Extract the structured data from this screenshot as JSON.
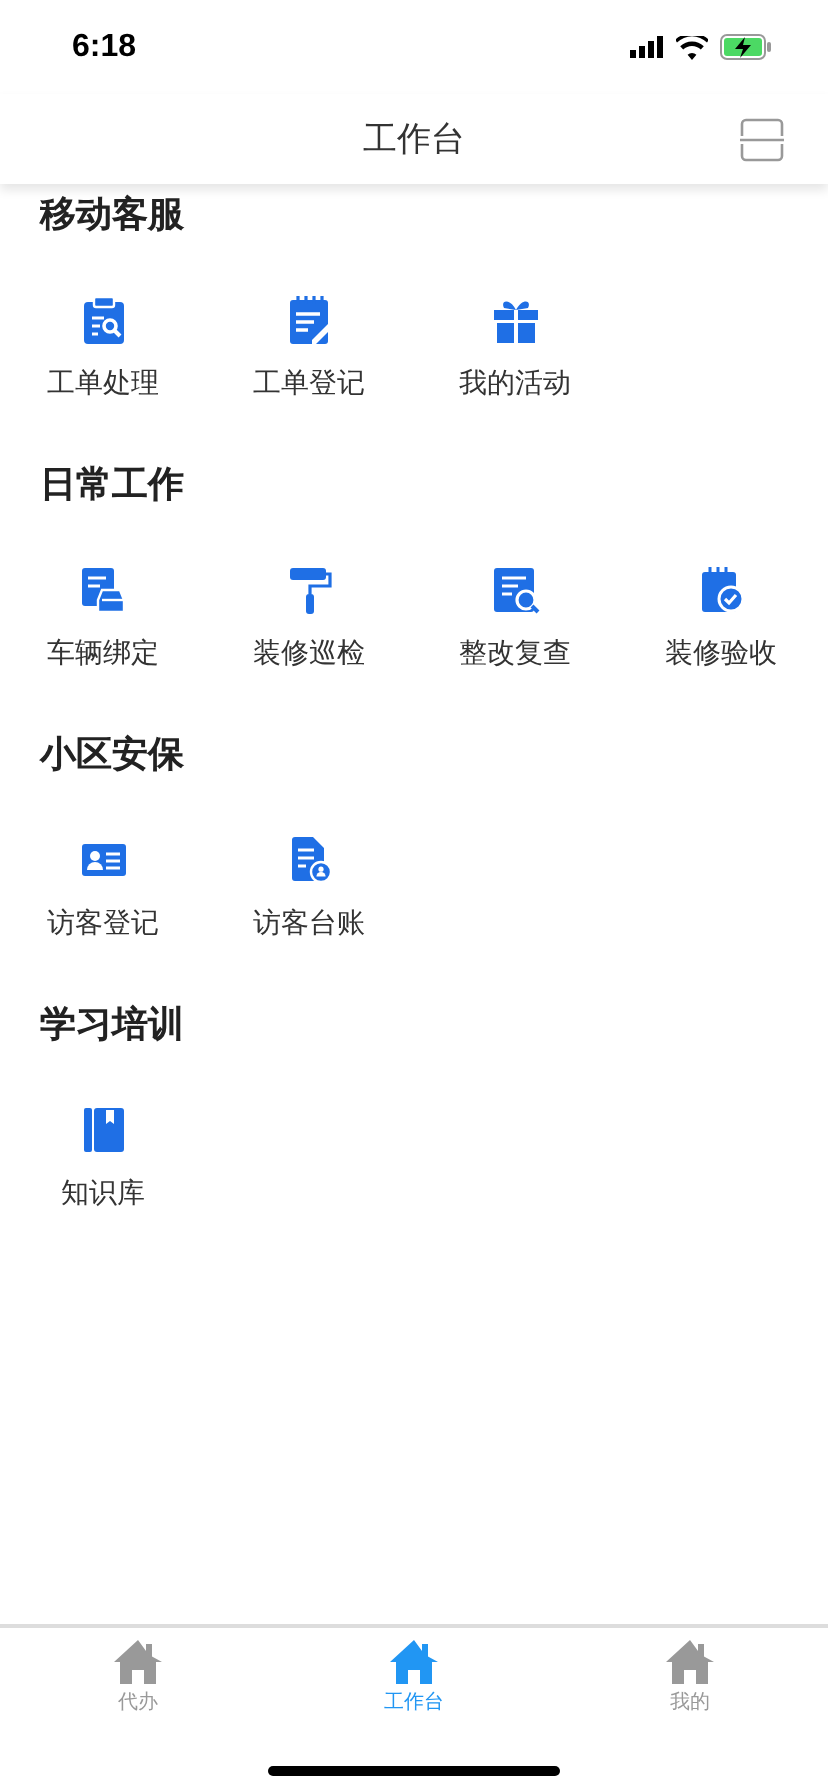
{
  "status_bar": {
    "time": "6:18"
  },
  "nav": {
    "title": "工作台"
  },
  "sections": [
    {
      "title": "移动客服",
      "items": [
        {
          "label": "工单处理",
          "kind": "clipboard"
        },
        {
          "label": "工单登记",
          "kind": "notepad"
        },
        {
          "label": "我的活动",
          "kind": "gift"
        }
      ]
    },
    {
      "title": "日常工作",
      "items": [
        {
          "label": "车辆绑定",
          "kind": "car"
        },
        {
          "label": "装修巡检",
          "kind": "roller"
        },
        {
          "label": "整改复查",
          "kind": "search-doc"
        },
        {
          "label": "装修验收",
          "kind": "check-doc"
        }
      ]
    },
    {
      "title": "小区安保",
      "items": [
        {
          "label": "访客登记",
          "kind": "idcard"
        },
        {
          "label": "访客台账",
          "kind": "user-doc"
        }
      ]
    },
    {
      "title": "学习培训",
      "items": [
        {
          "label": "知识库",
          "kind": "book"
        }
      ]
    }
  ],
  "tabs": [
    {
      "label": "代办",
      "selected": false
    },
    {
      "label": "工作台",
      "selected": true
    },
    {
      "label": "我的",
      "selected": false
    }
  ]
}
